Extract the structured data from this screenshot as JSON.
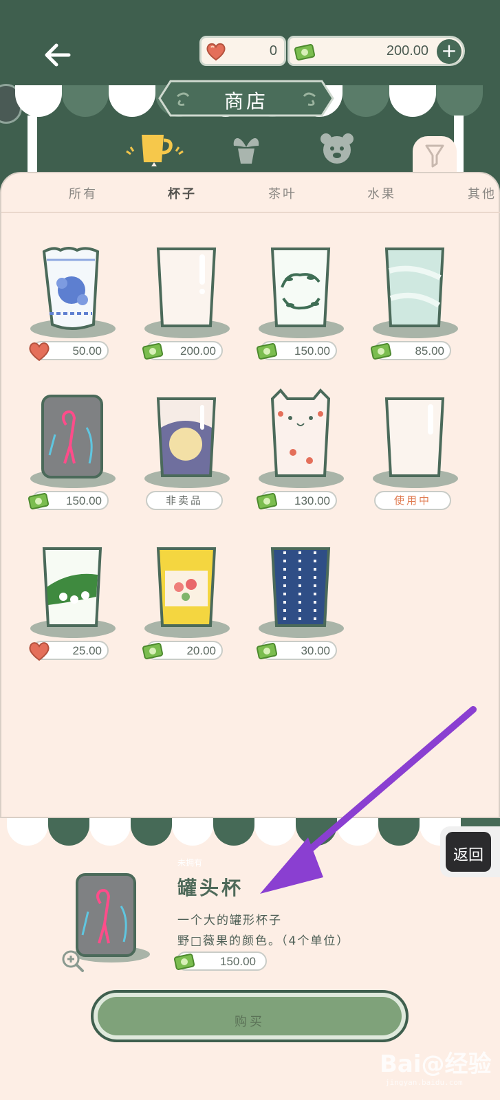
{
  "header": {
    "hearts": "0",
    "money": "200.00",
    "shop_title": "商店"
  },
  "tabs": [
    {
      "label": "所有",
      "active": false
    },
    {
      "label": "杯子",
      "active": true
    },
    {
      "label": "茶叶",
      "active": false
    },
    {
      "label": "水果",
      "active": false
    },
    {
      "label": "其他",
      "active": false
    }
  ],
  "items": [
    {
      "name": "blue-floral-cup",
      "price": "50.00",
      "currency": "heart",
      "status": ""
    },
    {
      "name": "plain-cup",
      "price": "200.00",
      "currency": "cash",
      "status": ""
    },
    {
      "name": "leaf-wreath-cup",
      "price": "150.00",
      "currency": "cash",
      "status": ""
    },
    {
      "name": "marble-cup",
      "price": "85.00",
      "currency": "cash",
      "status": ""
    },
    {
      "name": "can-cup",
      "price": "150.00",
      "currency": "cash",
      "status": ""
    },
    {
      "name": "moon-cup",
      "price": "",
      "currency": "",
      "status": "非卖品"
    },
    {
      "name": "cat-cup",
      "price": "130.00",
      "currency": "cash",
      "status": ""
    },
    {
      "name": "default-cup",
      "price": "",
      "currency": "",
      "status": "使用中"
    },
    {
      "name": "lily-cup",
      "price": "25.00",
      "currency": "heart",
      "status": ""
    },
    {
      "name": "yellow-flower-cup",
      "price": "20.00",
      "currency": "cash",
      "status": ""
    },
    {
      "name": "blue-dots-cup",
      "price": "30.00",
      "currency": "cash",
      "status": ""
    }
  ],
  "detail": {
    "badge": "未拥有",
    "title": "罐头杯",
    "desc_line1": "一个大的罐形杯子",
    "desc_line2": "野□薇果的颜色。（4个单位）",
    "price": "150.00",
    "buy_label": "购买"
  },
  "return_label": "返回",
  "watermark": {
    "text": "Bai@经验",
    "sub": "jingyan.baidu.com"
  },
  "colors": {
    "dark_green": "#3f5f4e",
    "panel_bg": "#fdeee5",
    "annotation_purple": "#8a3fd1",
    "in_use_orange": "#e07a4f"
  }
}
